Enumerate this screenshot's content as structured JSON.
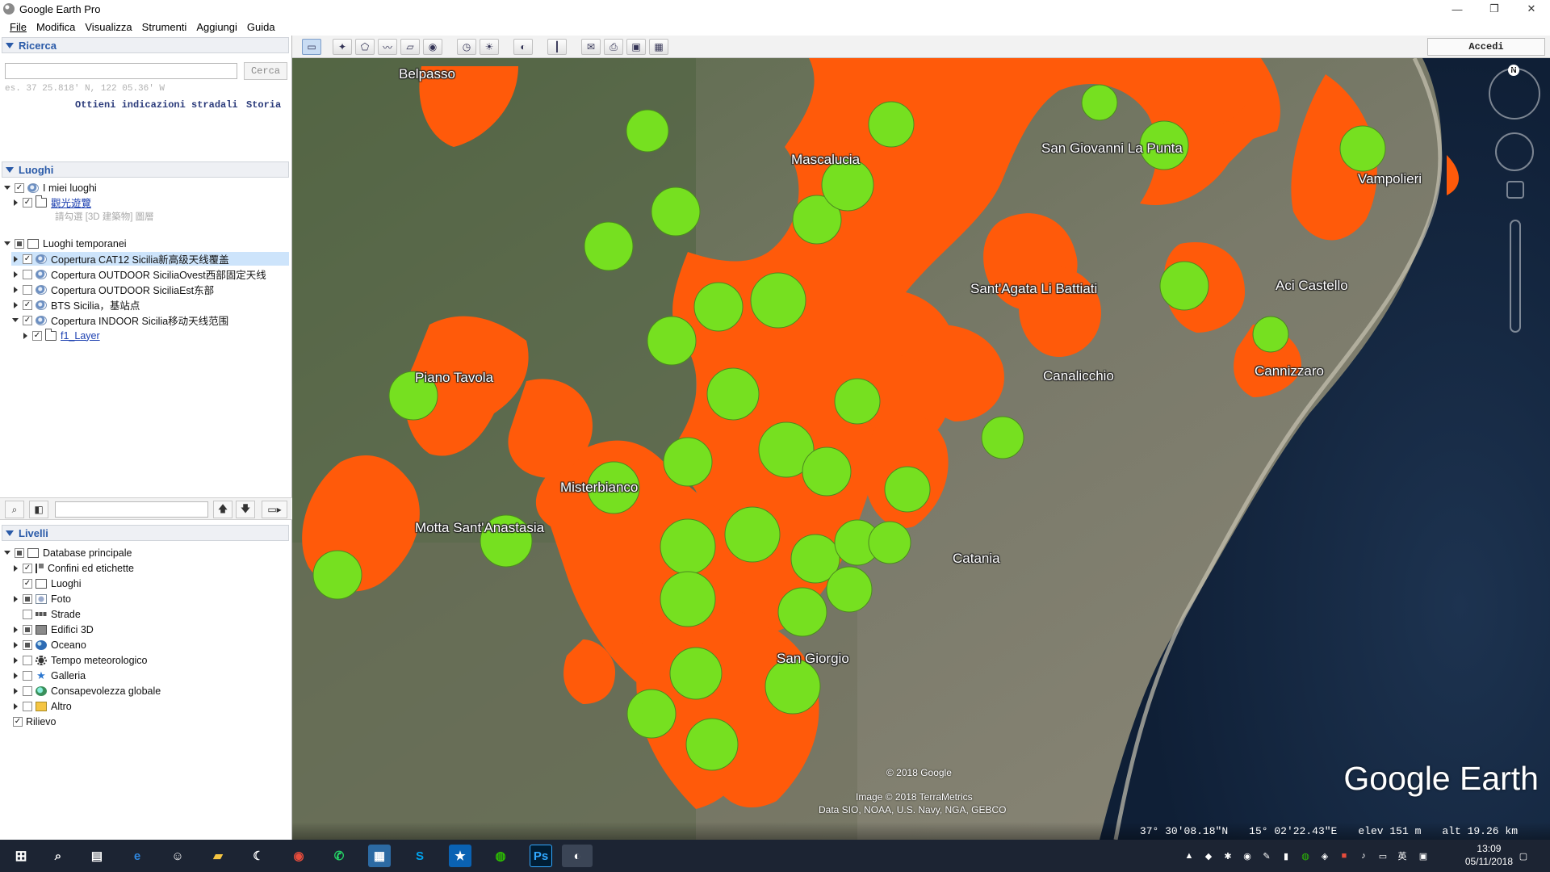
{
  "window": {
    "title": "Google Earth Pro"
  },
  "menu": [
    "File",
    "Modifica",
    "Visualizza",
    "Strumenti",
    "Aggiungi",
    "Guida"
  ],
  "search": {
    "header": "Ricerca",
    "input_value": "",
    "button_label": "Cerca",
    "hint": "es. 37 25.818' N, 122 05.36' W",
    "directions_link": "Ottieni indicazioni stradali",
    "history_link": "Storia"
  },
  "places": {
    "header": "Luoghi",
    "my_places": "I miei luoghi",
    "tour_folder": "觀光遊覽",
    "tour_sub": "請勾選 [3D 建築物] 圖層",
    "temp_places": "Luoghi temporanei",
    "items": [
      "Copertura CAT12 Sicilia新高级天线覆盖",
      "Copertura OUTDOOR SiciliaOvest西部固定天线",
      "Copertura OUTDOOR SiciliaEst东部",
      "BTS Sicilia，基站点",
      "Copertura INDOOR Sicilia移动天线范围"
    ],
    "sub_layer": "f1_Layer"
  },
  "layers": {
    "header": "Livelli",
    "root": "Database principale",
    "items": [
      "Confini ed etichette",
      "Luoghi",
      "Foto",
      "Strade",
      "Edifici 3D",
      "Oceano",
      "Tempo meteorologico",
      "Galleria",
      "Consapevolezza globale",
      "Altro"
    ],
    "relief": "Rilievo"
  },
  "toolbar": {
    "signin_label": "Accedi"
  },
  "map": {
    "labels": [
      "Belpasso",
      "Mascalucia",
      "San Giovanni La Punta",
      "Vampolieri",
      "Sant'Agata Li Battiati",
      "Aci Castello",
      "Canalicchio",
      "Cannizzaro",
      "Piano Tavola",
      "Misterbianco",
      "Motta Sant'Anastasia",
      "Catania",
      "San Giorgio"
    ],
    "copyright": "© 2018 Google",
    "imagery": "Image © 2018 TerraMetrics",
    "data_credit": "Data SIO, NOAA, U.S. Navy, NGA, GEBCO",
    "brand": "Google Earth",
    "status": {
      "lat": "37° 30′08.18″N",
      "lon": "15° 02′22.43″E",
      "elev": "elev   151 m",
      "alt": "alt  19.26 km"
    },
    "coverage_colors": {
      "outdoor": "#ff5a0a",
      "indoor": "#76e020"
    }
  },
  "taskbar": {
    "time": "13:09",
    "date": "05/11/2018",
    "lang": "英"
  }
}
